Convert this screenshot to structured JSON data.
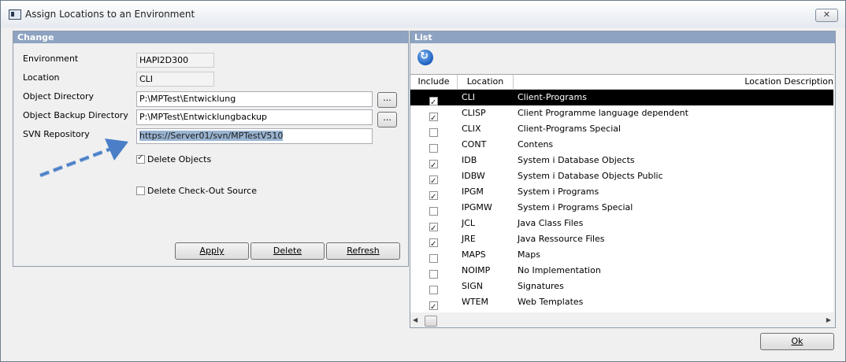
{
  "window": {
    "title": "Assign Locations to an Environment",
    "close_label": "✕"
  },
  "change": {
    "header": "Change",
    "environment_label": "Environment",
    "environment_value": "HAPI2D300",
    "location_label": "Location",
    "location_value": "CLI",
    "object_dir_label": "Object Directory",
    "object_dir_value": "P:\\MPTest\\Entwicklung",
    "backup_dir_label": "Object Backup Directory",
    "backup_dir_value": "P:\\MPTest\\Entwicklungbackup",
    "svn_label": "SVN Repository",
    "svn_value": "https://Server01/svn/MPTestV510",
    "browse_label": "...",
    "delete_objects_label": "Delete Objects",
    "delete_objects_checked": true,
    "delete_checkout_label": "Delete Check-Out Source",
    "delete_checkout_checked": false,
    "apply_label": "Apply",
    "delete_label": "Delete",
    "refresh_label": "Refresh"
  },
  "list": {
    "header": "List",
    "refresh_icon": "refresh-icon",
    "columns": [
      "Include",
      "Location",
      "Location Description"
    ],
    "rows": [
      {
        "include": true,
        "location": "CLI",
        "description": "Client-Programs"
      },
      {
        "include": true,
        "location": "CLISP",
        "description": "Client Programme language dependent"
      },
      {
        "include": false,
        "location": "CLIX",
        "description": "Client-Programs Special"
      },
      {
        "include": false,
        "location": "CONT",
        "description": "Contens"
      },
      {
        "include": true,
        "location": "IDB",
        "description": "System i Database Objects"
      },
      {
        "include": true,
        "location": "IDBW",
        "description": "System i Database Objects Public"
      },
      {
        "include": true,
        "location": "IPGM",
        "description": "System i Programs"
      },
      {
        "include": false,
        "location": "IPGMW",
        "description": "System i Programs Special"
      },
      {
        "include": true,
        "location": "JCL",
        "description": "Java Class Files"
      },
      {
        "include": true,
        "location": "JRE",
        "description": "Java Ressource Files"
      },
      {
        "include": false,
        "location": "MAPS",
        "description": "Maps"
      },
      {
        "include": false,
        "location": "NOIMP",
        "description": "No Implementation"
      },
      {
        "include": false,
        "location": "SIGN",
        "description": "Signatures"
      },
      {
        "include": true,
        "location": "WTEM",
        "description": "Web Templates"
      }
    ]
  },
  "footer": {
    "ok_label": "Ok"
  },
  "annotation": {
    "arrow_color": "#4a7fc8"
  }
}
